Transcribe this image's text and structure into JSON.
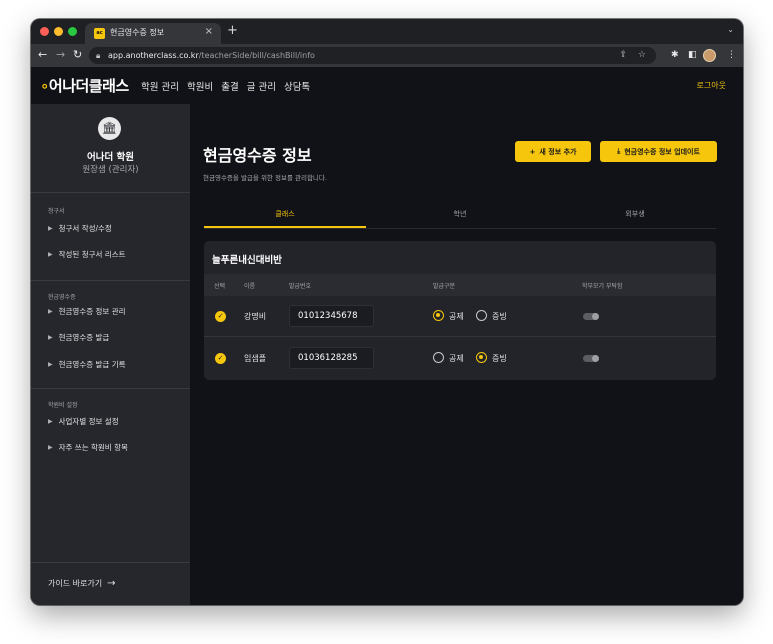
{
  "browser": {
    "tab_title": "현금영수증 정보",
    "tab_favicon_text": "ac",
    "tab_close": "×",
    "new_tab": "+",
    "url_host": "app.anotherclass.co.kr",
    "url_path": "/teacherSide/bill/cashBill/info"
  },
  "header": {
    "logo_mark": "∘",
    "logo_text": "어나더클래스",
    "nav": [
      "학원 관리",
      "학원비",
      "출결",
      "글 관리",
      "상담톡"
    ],
    "logout_label": "로그아웃"
  },
  "sidebar": {
    "academy_name": "어나더 학원",
    "academy_role": "원장샘 (관리자)",
    "sections": [
      {
        "title": "청구서",
        "items": [
          "청구서 작성/수정",
          "작성된 청구서 리스트"
        ]
      },
      {
        "title": "현금영수증",
        "items": [
          "현금영수증 정보 관리",
          "현금영수증 발급",
          "현금영수증 발급 기록"
        ]
      },
      {
        "title": "학원비 설정",
        "items": [
          "사업자별 정보 설정",
          "자주 쓰는 학원비 항목"
        ]
      }
    ],
    "guide_link": "가이드 바로가기"
  },
  "main": {
    "title": "현금영수증 정보",
    "subtitle": "현금영수증을 발급을 위한 정보를 관리합니다.",
    "add_button": "새 정보 추가",
    "add_button_icon": "+",
    "upload_button": "현금영수증 정보 업데이트",
    "tabs": [
      "클래스",
      "학년",
      "외부생"
    ],
    "active_tab": 0,
    "card": {
      "title": "늘푸른내신대비반",
      "columns": [
        "선택",
        "이름",
        "발급번호",
        "발급구분",
        "학부모기 부탁함"
      ],
      "rows": [
        {
          "name": "강명비",
          "number": "01012345678",
          "option_a": "공제",
          "option_b": "증빙",
          "selected": "공제",
          "toggle": false
        },
        {
          "name": "임샘플",
          "number": "01036128285",
          "option_a": "공제",
          "option_b": "증빙",
          "selected": "증빙",
          "toggle": false
        }
      ]
    }
  },
  "colors": {
    "accent": "#f5c60c",
    "sidebar_bg": "#26272c",
    "main_bg": "#111217",
    "card_bg": "#23242a"
  }
}
